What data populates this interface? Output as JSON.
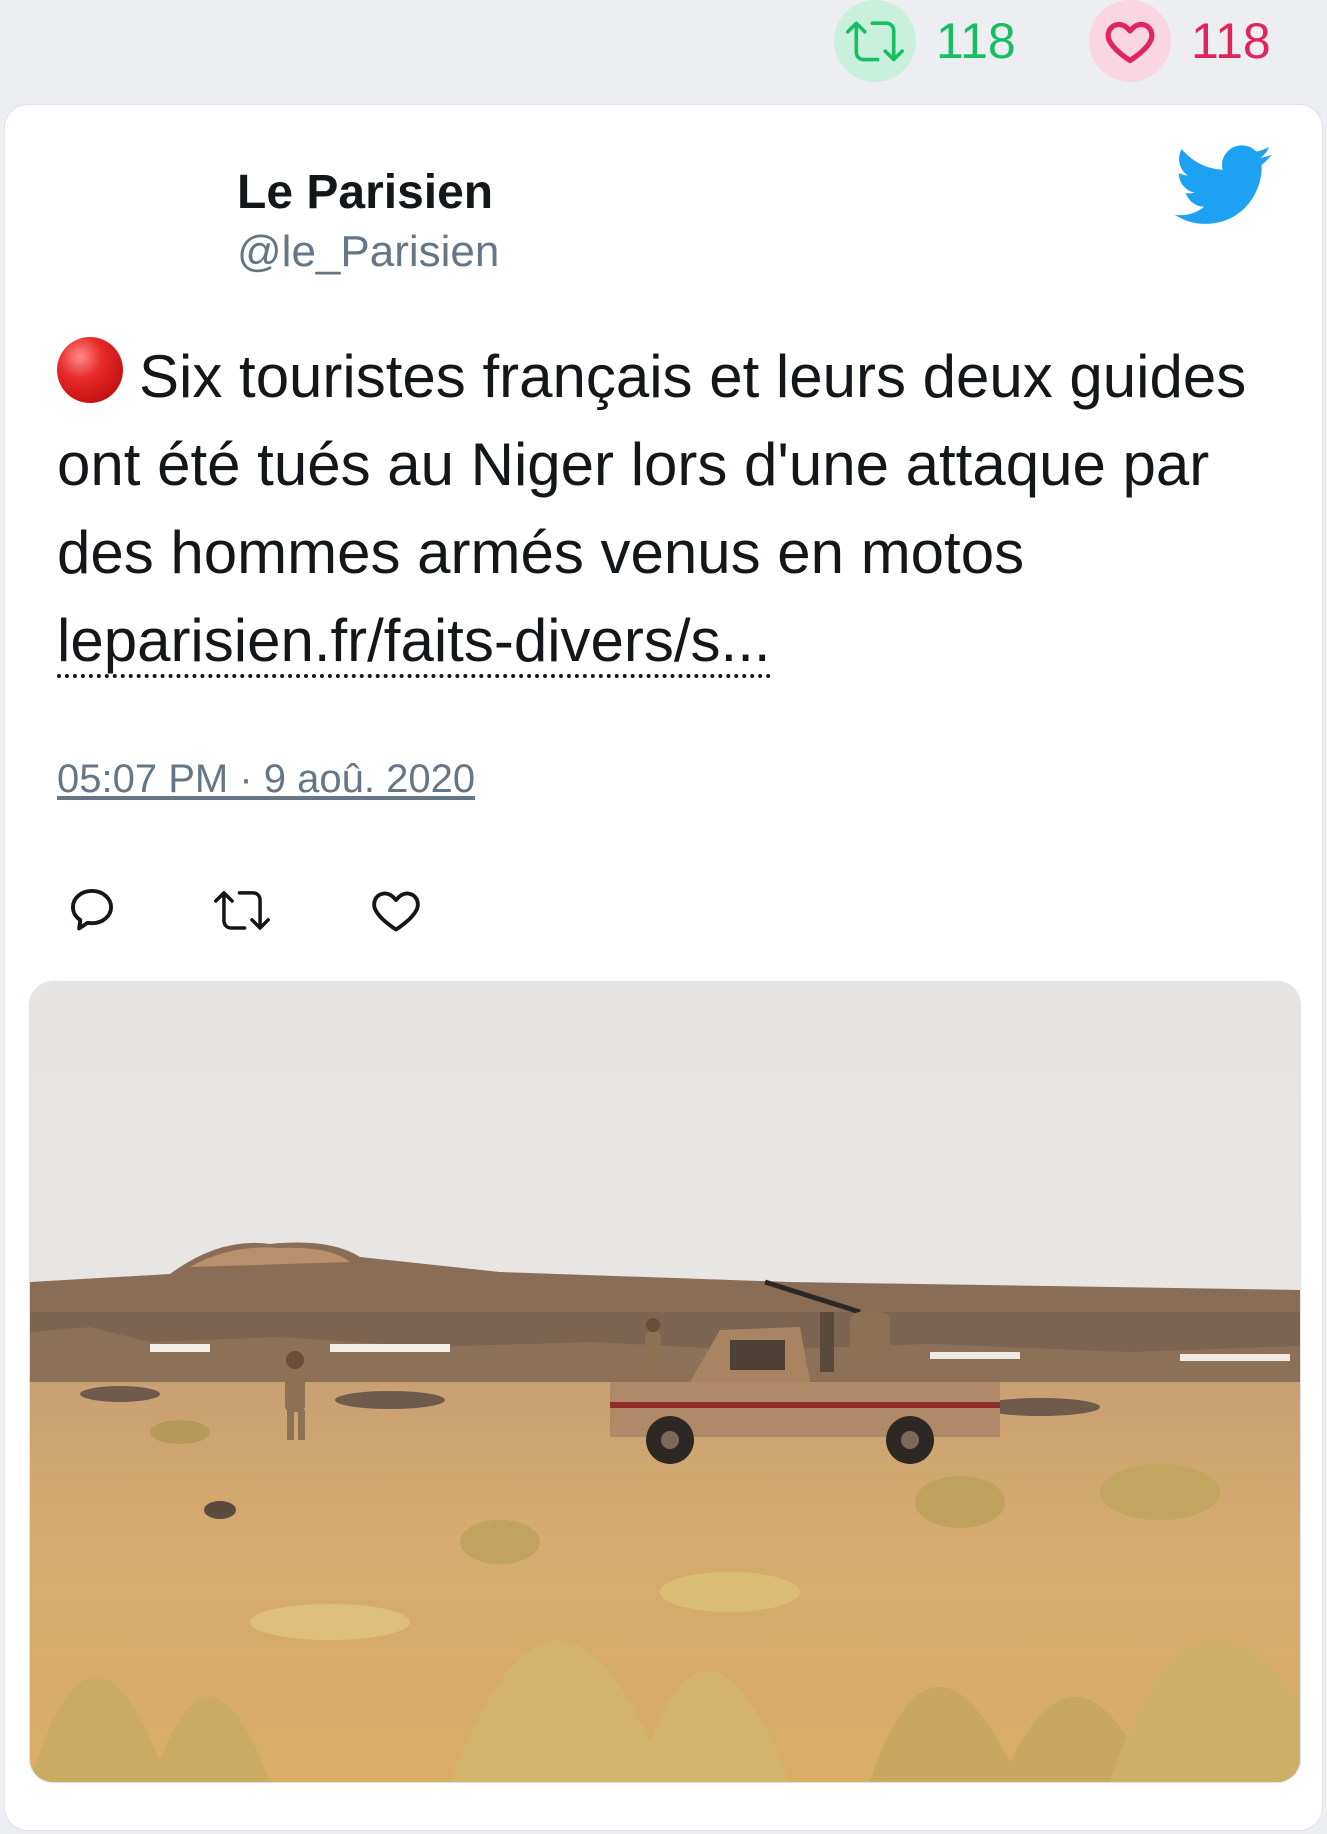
{
  "header": {
    "retweet_count": "118",
    "like_count": "118"
  },
  "tweet": {
    "author_name": "Le Parisien",
    "author_handle": "@le_Parisien",
    "text": "Six touristes français et leurs deux guides ont été tués au Niger lors d'une attaque par des hommes armés venus en motos ",
    "link_text": "leparisien.fr/faits-divers/s...",
    "timestamp": "05:07 PM · 9 aoû. 2020"
  },
  "icons": {
    "top_retweet": "retweet-icon",
    "top_like": "heart-icon",
    "brand": "twitter-bird-icon",
    "reply": "reply-icon",
    "retweet": "retweet-icon",
    "like": "heart-icon",
    "emoji": "red-circle-emoji"
  },
  "colors": {
    "retweet_green": "#17bf63",
    "like_red": "#e0245e",
    "twitter_blue": "#1da1f2",
    "text_dark": "#14171a",
    "text_muted": "#657786"
  }
}
